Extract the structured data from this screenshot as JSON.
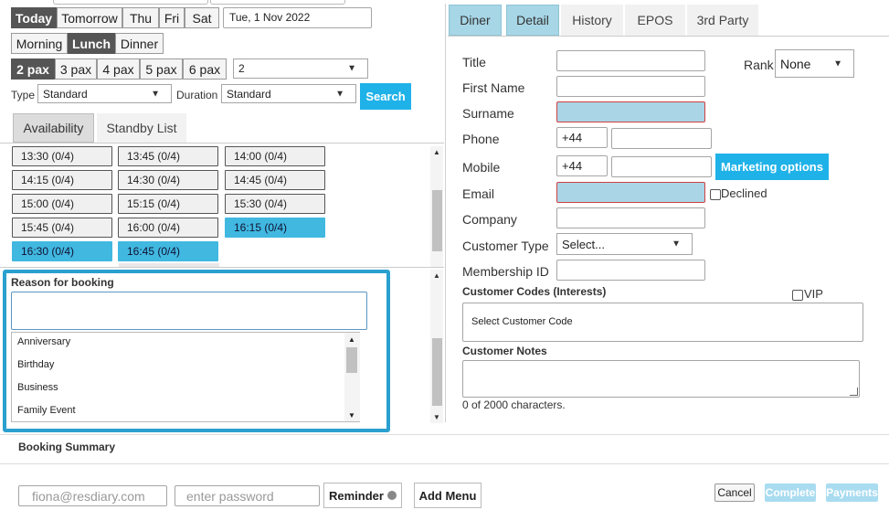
{
  "date_nav": {
    "buttons": [
      "Today",
      "Tomorrow",
      "Thu",
      "Fri",
      "Sat"
    ],
    "date_value": "Tue, 1 Nov 2022"
  },
  "meal": {
    "buttons": [
      "Morning",
      "Lunch",
      "Dinner"
    ]
  },
  "pax": {
    "buttons": [
      "2 pax",
      "3 pax",
      "4 pax",
      "5 pax",
      "6 pax"
    ],
    "select_value": "2"
  },
  "filters": {
    "type_label": "Type",
    "type_value": "Standard",
    "duration_label": "Duration",
    "duration_value": "Standard",
    "search_label": "Search"
  },
  "left_tabs": [
    "Availability",
    "Standby List"
  ],
  "slots": [
    {
      "label": "13:30 (0/4)",
      "highlighted": false
    },
    {
      "label": "13:45 (0/4)",
      "highlighted": false
    },
    {
      "label": "14:00 (0/4)",
      "highlighted": false
    },
    {
      "label": "14:15 (0/4)",
      "highlighted": false
    },
    {
      "label": "14:30 (0/4)",
      "highlighted": false
    },
    {
      "label": "14:45 (0/4)",
      "highlighted": false
    },
    {
      "label": "15:00 (0/4)",
      "highlighted": false
    },
    {
      "label": "15:15 (0/4)",
      "highlighted": false
    },
    {
      "label": "15:30 (0/4)",
      "highlighted": false
    },
    {
      "label": "15:45 (0/4)",
      "highlighted": false
    },
    {
      "label": "16:00 (0/4)",
      "highlighted": false
    },
    {
      "label": "16:15 (0/4)",
      "highlighted": true
    },
    {
      "label": "16:30 (0/4)",
      "highlighted": true
    },
    {
      "label": "16:45 (0/4)",
      "highlighted": true
    }
  ],
  "reason": {
    "title": "Reason for booking",
    "options": [
      "Anniversary",
      "Birthday",
      "Business",
      "Family Event"
    ]
  },
  "right_tabs": [
    "Diner",
    "Detail",
    "History",
    "EPOS",
    "3rd Party"
  ],
  "diner_form": {
    "title_label": "Title",
    "rank_label": "Rank",
    "rank_value": "None",
    "first_name_label": "First Name",
    "surname_label": "Surname",
    "phone_label": "Phone",
    "phone_code": "+44",
    "mobile_label": "Mobile",
    "mobile_code": "+44",
    "marketing_label": "Marketing options",
    "email_label": "Email",
    "declined_label": "Declined",
    "company_label": "Company",
    "customer_type_label": "Customer Type",
    "customer_type_value": "Select...",
    "membership_label": "Membership ID",
    "codes_label": "Customer Codes (Interests)",
    "vip_label": "VIP",
    "codes_placeholder": "Select Customer Code",
    "notes_label": "Customer Notes",
    "char_count": "0 of 2000 characters."
  },
  "summary": {
    "title": "Booking Summary"
  },
  "footer": {
    "email_value": "fiona@resdiary.com",
    "password_placeholder": "enter password",
    "reminder_label": "Reminder",
    "add_menu_label": "Add Menu",
    "cancel_label": "Cancel",
    "complete_label": "Complete",
    "payments_label": "Payments"
  },
  "colors": {
    "accent": "#1fb2e8",
    "highlight_slot": "#40b8e0",
    "focus_frame": "#2aa0cf",
    "error_field": "#a9d5e6"
  }
}
